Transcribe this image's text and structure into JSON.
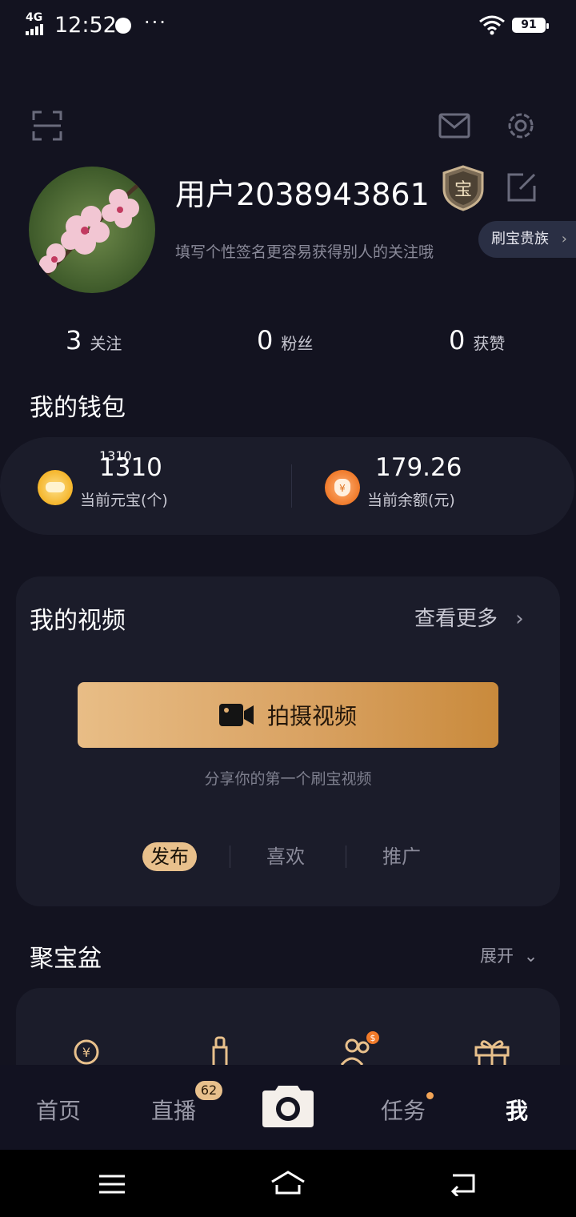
{
  "status_bar": {
    "network": "4G",
    "time": "12:52",
    "more": "···",
    "battery": "91"
  },
  "profile": {
    "username": "用户2038943861",
    "badge_text": "宝",
    "signature": "填写个性签名更容易获得别人的关注哦",
    "noble_label": "刷宝贵族",
    "stats": [
      {
        "value": "3",
        "label": "关注"
      },
      {
        "value": "0",
        "label": "粉丝"
      },
      {
        "value": "0",
        "label": "获赞"
      }
    ]
  },
  "wallet": {
    "title": "我的钱包",
    "items": [
      {
        "value": "1310",
        "label": "当前元宝(个)"
      },
      {
        "value": "179.26",
        "label": "当前余额(元)"
      }
    ]
  },
  "videos": {
    "title": "我的视频",
    "more_label": "查看更多",
    "shoot_label": "拍摄视频",
    "share_hint": "分享你的第一个刷宝视频",
    "tabs": [
      "发布",
      "喜欢",
      "推广"
    ]
  },
  "treasure": {
    "title": "聚宝盆",
    "expand_label": "展开"
  },
  "bottom_nav": {
    "items": [
      "首页",
      "直播",
      "任务",
      "我"
    ],
    "live_badge": "62"
  },
  "colors": {
    "background": "#131320",
    "card": "#1b1c2a",
    "accent_gold": "#e8c08c",
    "coin_yellow": "#f5b52a",
    "coin_orange": "#f07a2a"
  }
}
